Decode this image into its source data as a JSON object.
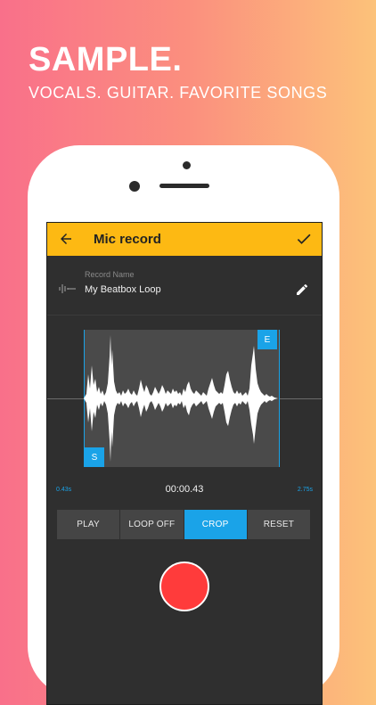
{
  "promo": {
    "headline": "SAMPLE.",
    "subline": "VOCALS. GUITAR. FAVORITE SONGS"
  },
  "app": {
    "title": "Mic record",
    "accent_color": "#fdb913",
    "highlight_color": "#1aa3e8",
    "record_color": "#ff3b3b"
  },
  "record_name": {
    "label": "Record Name",
    "value": "My Beatbox Loop"
  },
  "markers": {
    "start": "S",
    "end": "E"
  },
  "timeline": {
    "start": "0.43s",
    "current": "00:00.43",
    "end": "2.75s"
  },
  "controls": [
    {
      "label": "PLAY",
      "active": false
    },
    {
      "label": "LOOP OFF",
      "active": false
    },
    {
      "label": "CROP",
      "active": true
    },
    {
      "label": "RESET",
      "active": false
    }
  ],
  "icons": {
    "back": "arrow-left-icon",
    "confirm": "checkmark-icon",
    "waveform": "waveform-icon",
    "edit": "pencil-icon"
  }
}
